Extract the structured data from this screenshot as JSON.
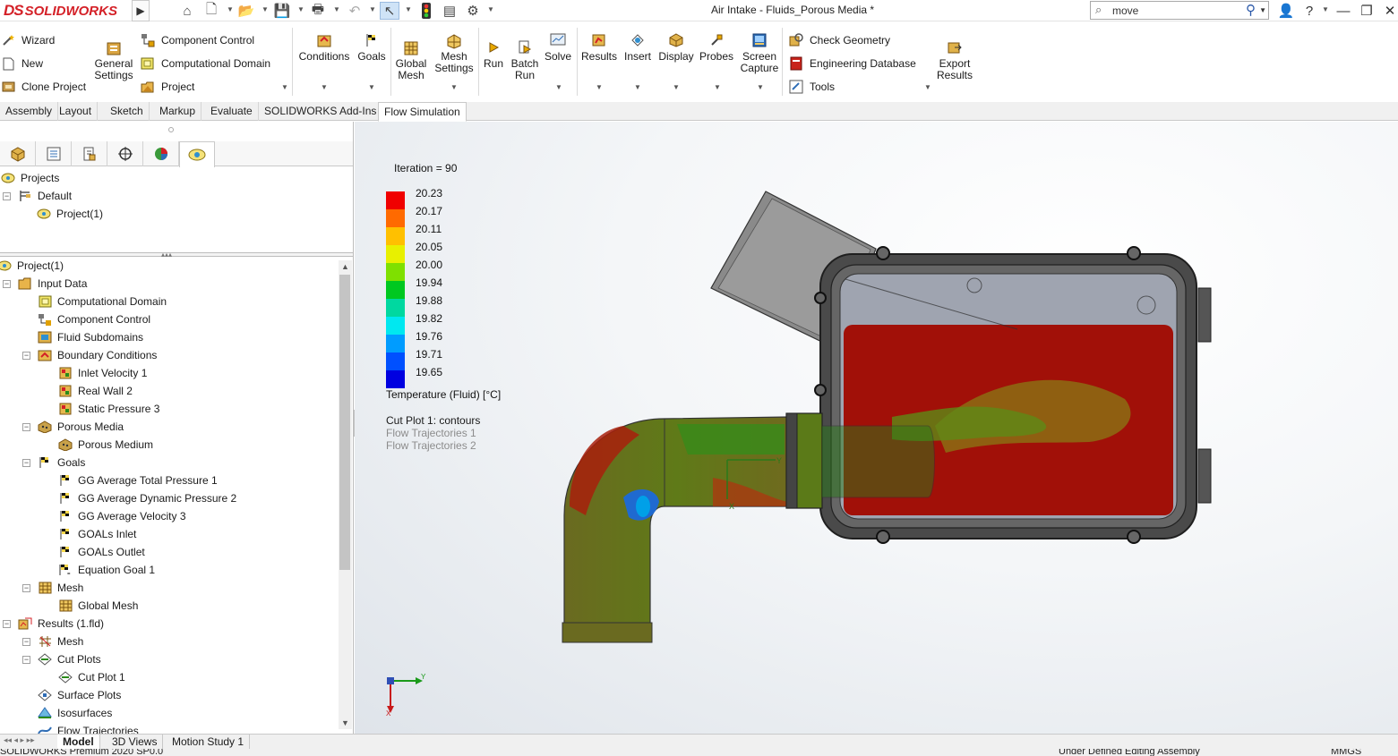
{
  "app": {
    "logo_prefix": "DS",
    "logo_name": "SOLIDWORKS",
    "window_title": "Air Intake - Fluids_Porous Media *",
    "search_value": "move",
    "accent": "#d42027"
  },
  "commands": {
    "col1": [
      "Wizard",
      "New",
      "Clone Project"
    ],
    "general_settings": "General\nSettings",
    "col2": [
      "Component Control",
      "Computational Domain",
      "Project"
    ],
    "conditions": "Conditions",
    "goals": "Goals",
    "global_mesh": [
      "Global",
      "Mesh"
    ],
    "mesh_settings": [
      "Mesh",
      "Settings"
    ],
    "run": "Run",
    "batch_run": [
      "Batch",
      "Run"
    ],
    "solve": "Solve",
    "results": "Results",
    "insert": "Insert",
    "display": "Display",
    "probes": "Probes",
    "screen_capture": [
      "Screen",
      "Capture"
    ],
    "col3": [
      "Check Geometry",
      "Engineering Database",
      "Tools"
    ],
    "export_results": [
      "Export",
      "Results"
    ]
  },
  "tabs": [
    "Assembly",
    "Layout",
    "Sketch",
    "Markup",
    "Evaluate",
    "SOLIDWORKS Add-Ins",
    "Flow Simulation"
  ],
  "active_tab": "Flow Simulation",
  "projects_tree": {
    "root": "Projects",
    "config": "Default",
    "project": "Project(1)"
  },
  "analysis_tree": [
    {
      "label": "Project(1)",
      "level": 0
    },
    {
      "label": "Input Data",
      "level": 1
    },
    {
      "label": "Computational Domain",
      "level": 2
    },
    {
      "label": "Component Control",
      "level": 2
    },
    {
      "label": "Fluid Subdomains",
      "level": 2
    },
    {
      "label": "Boundary Conditions",
      "level": 2
    },
    {
      "label": "Inlet Velocity 1",
      "level": 3
    },
    {
      "label": "Real Wall 2",
      "level": 3
    },
    {
      "label": "Static Pressure 3",
      "level": 3
    },
    {
      "label": "Porous Media",
      "level": 2
    },
    {
      "label": "Porous Medium",
      "level": 3
    },
    {
      "label": "Goals",
      "level": 2
    },
    {
      "label": "GG Average Total Pressure 1",
      "level": 3
    },
    {
      "label": "GG Average Dynamic Pressure 2",
      "level": 3
    },
    {
      "label": "GG Average Velocity 3",
      "level": 3
    },
    {
      "label": "GOALs Inlet",
      "level": 3
    },
    {
      "label": "GOALs Outlet",
      "level": 3
    },
    {
      "label": "Equation Goal 1",
      "level": 3
    },
    {
      "label": "Mesh",
      "level": 2
    },
    {
      "label": "Global Mesh",
      "level": 3
    },
    {
      "label": "Results (1.fld)",
      "level": 1
    },
    {
      "label": "Mesh",
      "level": 2
    },
    {
      "label": "Cut Plots",
      "level": 2
    },
    {
      "label": "Cut Plot 1",
      "level": 3
    },
    {
      "label": "Surface Plots",
      "level": 2
    },
    {
      "label": "Isosurfaces",
      "level": 2
    },
    {
      "label": "Flow Trajectories",
      "level": 2
    }
  ],
  "bottom_tabs": [
    "Model",
    "3D Views",
    "Motion Study 1"
  ],
  "status_bar": {
    "left": "SOLIDWORKS Premium 2020 SP0.0",
    "middle": "Under Defined   Editing Assembly",
    "right": "MMGS"
  },
  "viewport": {
    "iteration_label": "Iteration = 90",
    "legend_values": [
      "20.23",
      "20.17",
      "20.11",
      "20.05",
      "20.00",
      "19.94",
      "19.88",
      "19.82",
      "19.76",
      "19.71",
      "19.65"
    ],
    "legend_colors": [
      "#f00000",
      "#ff6a00",
      "#ffc000",
      "#e8f000",
      "#7fe000",
      "#00c820",
      "#00d8a0",
      "#00e8f0",
      "#009cff",
      "#0050ff",
      "#0000e0"
    ],
    "legend_title": "Temperature (Fluid) [°C]",
    "plots": [
      "Cut Plot 1: contours",
      "Flow Trajectories 1",
      "Flow Trajectories 2"
    ],
    "triad_y": "Y",
    "triad_x": "X"
  }
}
